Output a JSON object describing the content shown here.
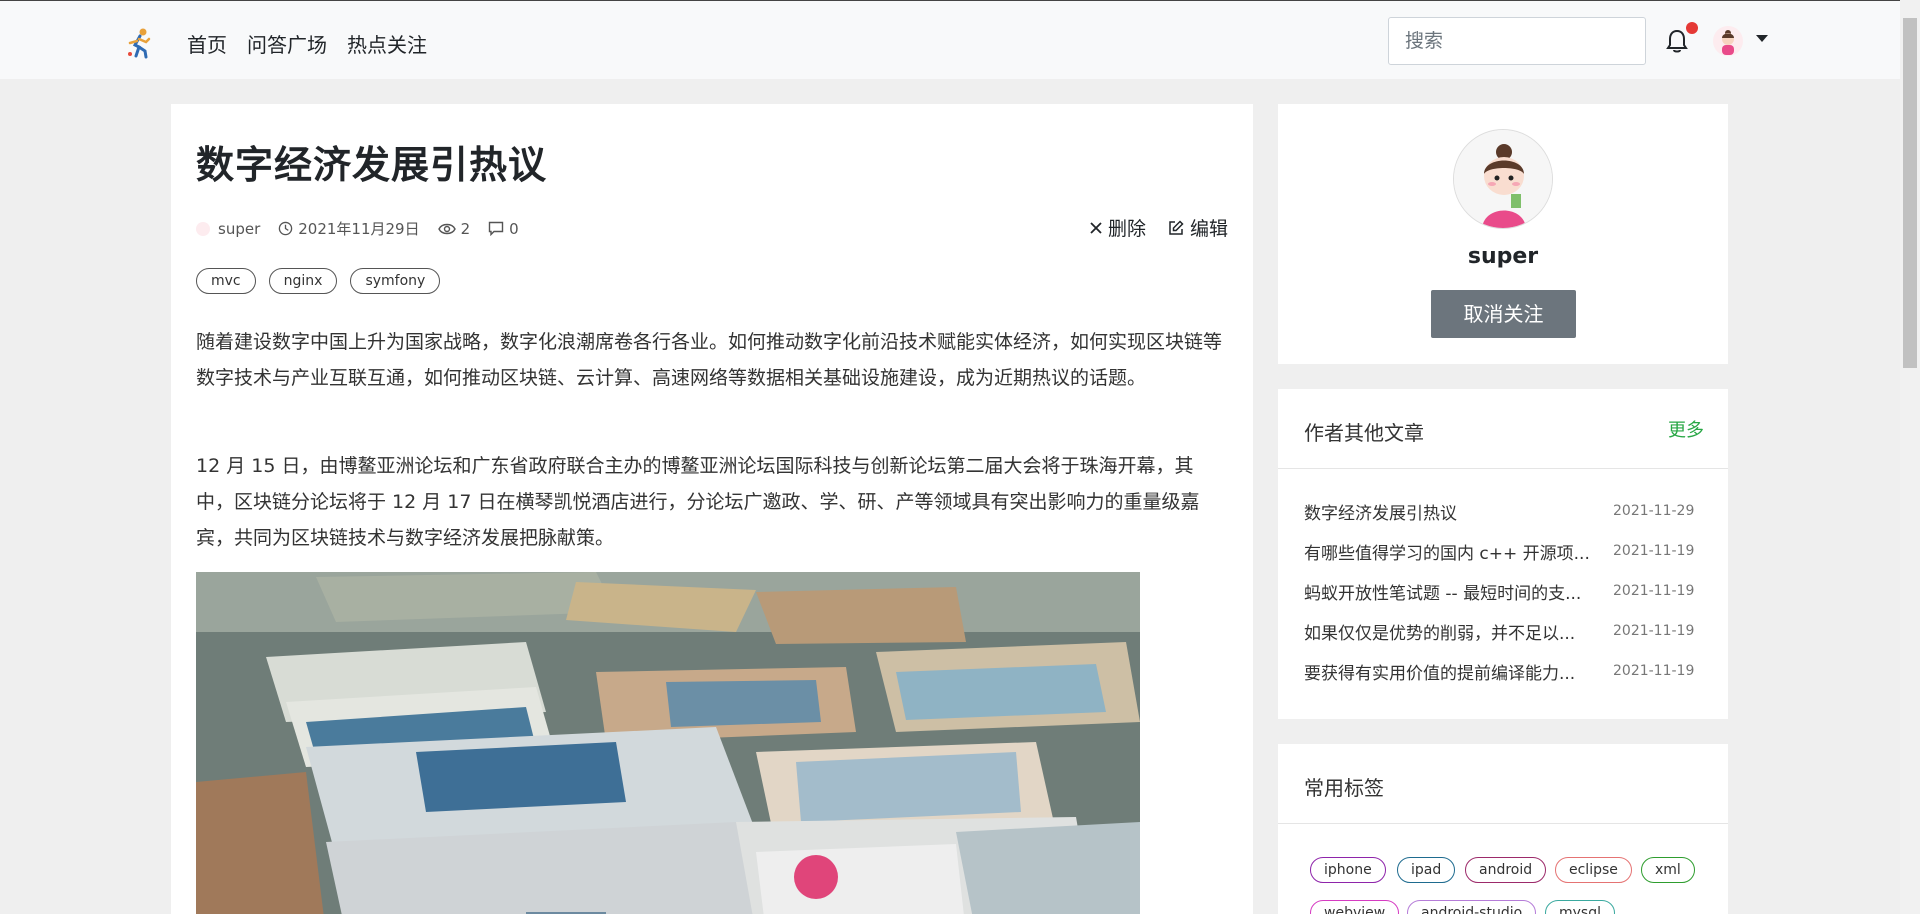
{
  "nav": {
    "links": [
      "首页",
      "问答广场",
      "热点关注"
    ],
    "search_placeholder": "搜索"
  },
  "article": {
    "title": "数字经济发展引热议",
    "author": "super",
    "date": "2021年11月29日",
    "views": "2",
    "comments": "0",
    "delete_label": "删除",
    "edit_label": "编辑",
    "tags": [
      "mvc",
      "nginx",
      "symfony"
    ],
    "paragraphs": [
      "随着建设数字中国上升为国家战略，数字化浪潮席卷各行各业。如何推动数字化前沿技术赋能实体经济，如何实现区块链等数字技术与产业互联互通，如何推动区块链、云计算、高速网络等数据相关基础设施建设，成为近期热议的话题。",
      "12 月 15 日，由博鳌亚洲论坛和广东省政府联合主办的博鳌亚洲论坛国际科技与创新论坛第二届大会将于珠海开幕，其中，区块链分论坛将于 12 月 17 日在横琴凯悦酒店进行，分论坛广邀政、学、研、产等领域具有突出影响力的重量级嘉宾，共同为区块链技术与数字经济发展把脉献策。"
    ]
  },
  "profile": {
    "name": "super",
    "unfollow_label": "取消关注"
  },
  "other_articles": {
    "title": "作者其他文章",
    "more_label": "更多",
    "items": [
      {
        "title": "数字经济发展引热议",
        "date": "2021-11-29"
      },
      {
        "title": "有哪些值得学习的国内 c++ 开源项...",
        "date": "2021-11-19"
      },
      {
        "title": "蚂蚁开放性笔试题 -- 最短时间的支...",
        "date": "2021-11-19"
      },
      {
        "title": "如果仅仅是优势的削弱，并不足以...",
        "date": "2021-11-19"
      },
      {
        "title": "要获得有实用价值的提前编译能力...",
        "date": "2021-11-19"
      }
    ]
  },
  "common_tags": {
    "title": "常用标签",
    "items": [
      {
        "label": "iphone",
        "color": "#8e24aa"
      },
      {
        "label": "ipad",
        "color": "#1e6b8f"
      },
      {
        "label": "android",
        "color": "#9c2a6a"
      },
      {
        "label": "eclipse",
        "color": "#e57373"
      },
      {
        "label": "xml",
        "color": "#2e9d2e"
      },
      {
        "label": "webview",
        "color": "#d63bc2"
      },
      {
        "label": "android-studio",
        "color": "#b57cd8"
      },
      {
        "label": "mysql",
        "color": "#3aa99f"
      }
    ]
  }
}
